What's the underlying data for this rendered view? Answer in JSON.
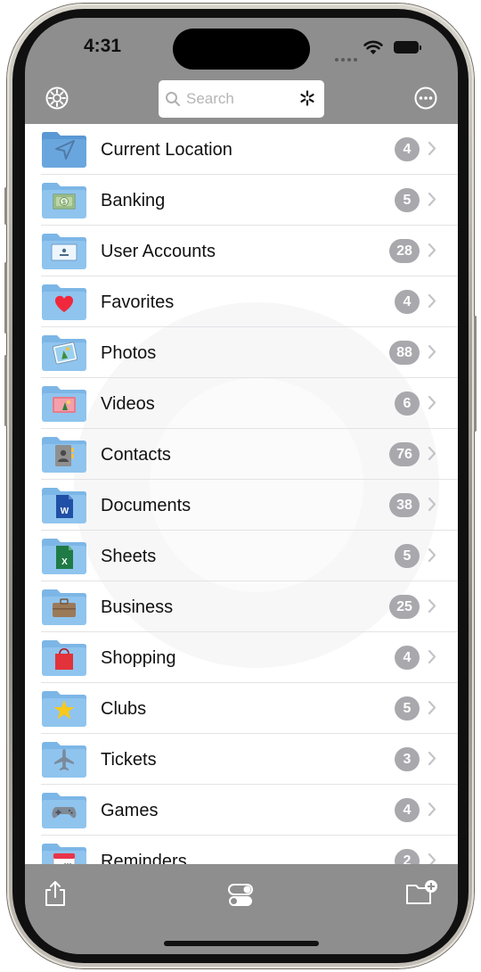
{
  "status_bar": {
    "time": "4:31"
  },
  "search": {
    "placeholder": "Search"
  },
  "colors": {
    "accent_folder": "#8fc4ee",
    "badge": "#a8a8ad",
    "bars": "#8e8e8e"
  },
  "folders": [
    {
      "label": "Current Location",
      "count": "4",
      "icon": "location-arrow-icon"
    },
    {
      "label": "Banking",
      "count": "5",
      "icon": "banknote-icon"
    },
    {
      "label": "User Accounts",
      "count": "28",
      "icon": "id-card-icon"
    },
    {
      "label": "Favorites",
      "count": "4",
      "icon": "heart-icon"
    },
    {
      "label": "Photos",
      "count": "88",
      "icon": "photo-icon"
    },
    {
      "label": "Videos",
      "count": "6",
      "icon": "video-icon"
    },
    {
      "label": "Contacts",
      "count": "76",
      "icon": "contact-book-icon"
    },
    {
      "label": "Documents",
      "count": "38",
      "icon": "word-document-icon"
    },
    {
      "label": "Sheets",
      "count": "5",
      "icon": "excel-sheet-icon"
    },
    {
      "label": "Business",
      "count": "25",
      "icon": "briefcase-icon"
    },
    {
      "label": "Shopping",
      "count": "4",
      "icon": "shopping-bag-icon"
    },
    {
      "label": "Clubs",
      "count": "5",
      "icon": "star-icon"
    },
    {
      "label": "Tickets",
      "count": "3",
      "icon": "airplane-icon"
    },
    {
      "label": "Games",
      "count": "4",
      "icon": "gamepad-icon"
    },
    {
      "label": "Reminders",
      "count": "2",
      "icon": "calendar-icon"
    }
  ],
  "toolbar": {
    "share_icon": "share-icon",
    "toggle_icon": "toggles-icon",
    "new_folder_icon": "new-folder-icon"
  }
}
